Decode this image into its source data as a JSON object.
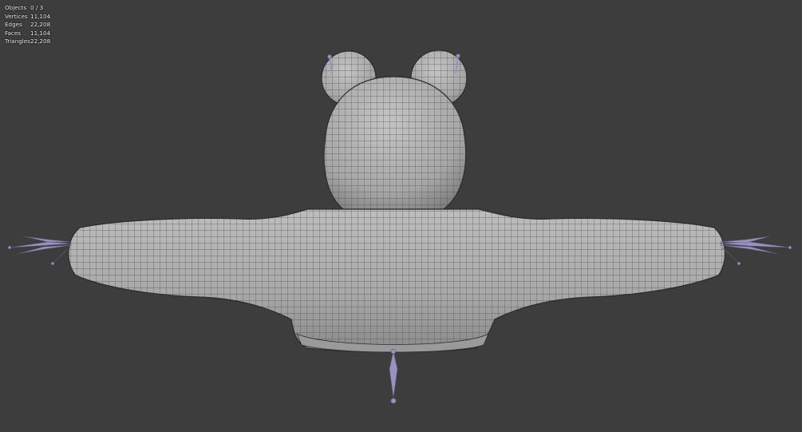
{
  "viewport": {
    "background_color": "#3d3d3d",
    "mesh_color": "#a9a9a9",
    "wire_color": "#4a4a4a",
    "bone_color": "#9a92be"
  },
  "stats": [
    {
      "label": "Objects",
      "value": "0 / 3"
    },
    {
      "label": "Vertices",
      "value": "11,104"
    },
    {
      "label": "Edges",
      "value": "22,208"
    },
    {
      "label": "Faces",
      "value": "11,104"
    },
    {
      "label": "Triangles",
      "value": "22,208"
    }
  ]
}
